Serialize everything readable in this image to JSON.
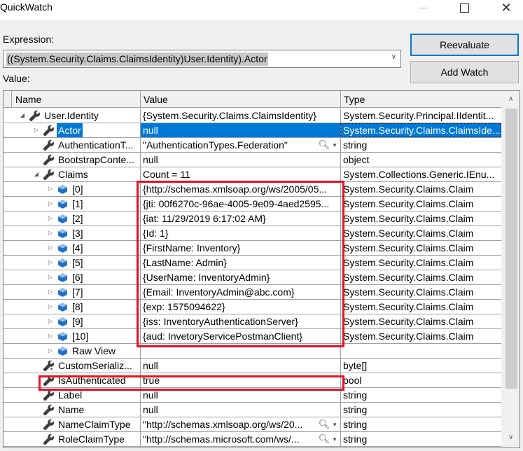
{
  "window": {
    "title": "QuickWatch",
    "minimize_icon": "minimize-icon",
    "maximize_icon": "maximize-icon",
    "close_icon": "close-icon"
  },
  "expression": {
    "label": "Expression:",
    "value": "((System.Security.Claims.ClaimsIdentity)User.Identity).Actor"
  },
  "buttons": {
    "reevaluate": "Reevaluate",
    "add_watch": "Add Watch"
  },
  "value_label": "Value:",
  "grid": {
    "columns": [
      "Name",
      "Value",
      "Type"
    ],
    "rows": [
      {
        "depth": 0,
        "expander": "expanded",
        "icon": "wrench-icon",
        "name": "User.Identity",
        "value": "{System.Security.Claims.ClaimsIdentity}",
        "type": "System.Security.Principal.IIdentit...",
        "selected": false,
        "search": false
      },
      {
        "depth": 1,
        "expander": "collapsed",
        "icon": "wrench-icon",
        "name": "Actor",
        "value": "null",
        "type": "System.Security.Claims.ClaimsIde...",
        "selected": true,
        "search": false
      },
      {
        "depth": 1,
        "expander": "none",
        "icon": "wrench-icon",
        "name": "AuthenticationT...",
        "value": "\"AuthenticationTypes.Federation\"",
        "type": "string",
        "selected": false,
        "search": true
      },
      {
        "depth": 1,
        "expander": "none",
        "icon": "wrench-icon",
        "name": "BootstrapConte...",
        "value": "null",
        "type": "object",
        "selected": false,
        "search": false
      },
      {
        "depth": 1,
        "expander": "expanded",
        "icon": "wrench-icon",
        "name": "Claims",
        "value": "Count = 11",
        "type": "System.Collections.Generic.IEnu...",
        "selected": false,
        "search": false
      },
      {
        "depth": 2,
        "expander": "collapsed",
        "icon": "cube-icon",
        "name": "[0]",
        "value": "{http://schemas.xmlsoap.org/ws/2005/05...",
        "type": "System.Security.Claims.Claim",
        "selected": false,
        "search": false
      },
      {
        "depth": 2,
        "expander": "collapsed",
        "icon": "cube-icon",
        "name": "[1]",
        "value": "{jti: 00f6270c-96ae-4005-9e09-4aed2595...",
        "type": "System.Security.Claims.Claim",
        "selected": false,
        "search": false
      },
      {
        "depth": 2,
        "expander": "collapsed",
        "icon": "cube-icon",
        "name": "[2]",
        "value": "{iat: 11/29/2019 6:17:02 AM}",
        "type": "System.Security.Claims.Claim",
        "selected": false,
        "search": false
      },
      {
        "depth": 2,
        "expander": "collapsed",
        "icon": "cube-icon",
        "name": "[3]",
        "value": "{Id: 1}",
        "type": "System.Security.Claims.Claim",
        "selected": false,
        "search": false
      },
      {
        "depth": 2,
        "expander": "collapsed",
        "icon": "cube-icon",
        "name": "[4]",
        "value": "{FirstName: Inventory}",
        "type": "System.Security.Claims.Claim",
        "selected": false,
        "search": false
      },
      {
        "depth": 2,
        "expander": "collapsed",
        "icon": "cube-icon",
        "name": "[5]",
        "value": "{LastName: Admin}",
        "type": "System.Security.Claims.Claim",
        "selected": false,
        "search": false
      },
      {
        "depth": 2,
        "expander": "collapsed",
        "icon": "cube-icon",
        "name": "[6]",
        "value": "{UserName: InventoryAdmin}",
        "type": "System.Security.Claims.Claim",
        "selected": false,
        "search": false
      },
      {
        "depth": 2,
        "expander": "collapsed",
        "icon": "cube-icon",
        "name": "[7]",
        "value": "{Email: InventoryAdmin@abc.com}",
        "type": "System.Security.Claims.Claim",
        "selected": false,
        "search": false
      },
      {
        "depth": 2,
        "expander": "collapsed",
        "icon": "cube-icon",
        "name": "[8]",
        "value": "{exp: 1575094622}",
        "type": "System.Security.Claims.Claim",
        "selected": false,
        "search": false
      },
      {
        "depth": 2,
        "expander": "collapsed",
        "icon": "cube-icon",
        "name": "[9]",
        "value": "{iss: InventoryAuthenticationServer}",
        "type": "System.Security.Claims.Claim",
        "selected": false,
        "search": false
      },
      {
        "depth": 2,
        "expander": "collapsed",
        "icon": "cube-icon",
        "name": "[10]",
        "value": "{aud: InvetoryServicePostmanClient}",
        "type": "System.Security.Claims.Claim",
        "selected": false,
        "search": false
      },
      {
        "depth": 2,
        "expander": "collapsed",
        "icon": "cube-icon",
        "name": "Raw View",
        "value": "",
        "type": "",
        "selected": false,
        "search": false
      },
      {
        "depth": 1,
        "expander": "none",
        "icon": "wrench-star-icon",
        "name": "CustomSerializ...",
        "value": "null",
        "type": "byte[]",
        "selected": false,
        "search": false
      },
      {
        "depth": 1,
        "expander": "none",
        "icon": "wrench-icon",
        "name": "IsAuthenticated",
        "value": "true",
        "type": "bool",
        "selected": false,
        "search": false
      },
      {
        "depth": 1,
        "expander": "none",
        "icon": "wrench-icon",
        "name": "Label",
        "value": "null",
        "type": "string",
        "selected": false,
        "search": false
      },
      {
        "depth": 1,
        "expander": "none",
        "icon": "wrench-icon",
        "name": "Name",
        "value": "null",
        "type": "string",
        "selected": false,
        "search": false
      },
      {
        "depth": 1,
        "expander": "none",
        "icon": "wrench-icon",
        "name": "NameClaimType",
        "value": "\"http://schemas.xmlsoap.org/ws/20...",
        "type": "string",
        "selected": false,
        "search": true
      },
      {
        "depth": 1,
        "expander": "none",
        "icon": "wrench-icon",
        "name": "RoleClaimType",
        "value": "\"http://schemas.microsoft.com/ws/...",
        "type": "string",
        "selected": false,
        "search": true
      }
    ]
  },
  "colors": {
    "selection": "#0078d7",
    "highlight_box": "#e81123",
    "cube_icon": "#1e6fc5",
    "wrench_icon": "#3c3c3c"
  }
}
